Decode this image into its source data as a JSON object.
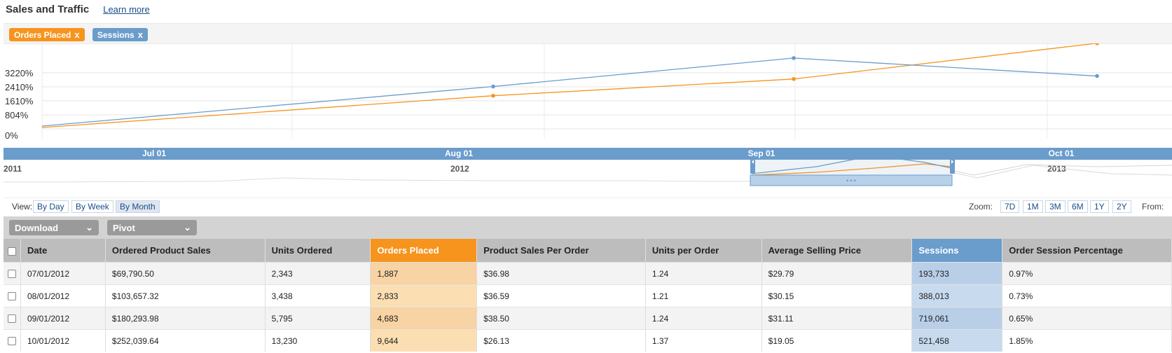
{
  "header": {
    "title": "Sales and Traffic",
    "learn_more": "Learn more"
  },
  "legend": {
    "orders_chip": {
      "label": "Orders Placed",
      "close": "x"
    },
    "sessions_chip": {
      "label": "Sessions",
      "close": "x"
    }
  },
  "colors": {
    "orders": "#f7941d",
    "sessions": "#6a9ccc",
    "axis_bar": "#6a9ccc"
  },
  "chart_data": {
    "type": "line",
    "x": [
      "Jul 01",
      "Aug 01",
      "Sep 01",
      "Oct 01"
    ],
    "y_ticks": [
      "0%",
      "804%",
      "1610%",
      "2410%",
      "3220%"
    ],
    "series": [
      {
        "name": "Orders Placed",
        "values": [
          0,
          1900,
          2860,
          4910
        ]
      },
      {
        "name": "Sessions",
        "values": [
          0,
          2430,
          4060,
          3030
        ]
      }
    ],
    "xlabel": "",
    "ylabel": "",
    "ylim": [
      0,
      4900
    ],
    "grid": true
  },
  "x_axis_labels": [
    "Jul 01",
    "Aug 01",
    "Sep 01",
    "Oct 01"
  ],
  "navigator": {
    "year_labels": [
      "2011",
      "2012",
      "2013"
    ],
    "handle_grip": "•••"
  },
  "view": {
    "label": "View:",
    "buttons": [
      "By Day",
      "By Week",
      "By Month"
    ],
    "active": "By Month"
  },
  "zoom": {
    "label": "Zoom:",
    "buttons": [
      "7D",
      "1M",
      "3M",
      "6M",
      "1Y",
      "2Y"
    ],
    "from_label": "From:"
  },
  "toolbar": {
    "download": "Download",
    "pivot": "Pivot",
    "chevron": "⌄"
  },
  "table": {
    "columns": [
      "Date",
      "Ordered Product Sales",
      "Units Ordered",
      "Orders Placed",
      "Product Sales Per Order",
      "Units per Order",
      "Average Selling Price",
      "Sessions",
      "Order Session Percentage"
    ],
    "rows": [
      [
        "07/01/2012",
        "$69,790.50",
        "2,343",
        "1,887",
        "$36.98",
        "1.24",
        "$29.79",
        "193,733",
        "0.97%"
      ],
      [
        "08/01/2012",
        "$103,657.32",
        "3,438",
        "2,833",
        "$36.59",
        "1.21",
        "$30.15",
        "388,013",
        "0.73%"
      ],
      [
        "09/01/2012",
        "$180,293.98",
        "5,795",
        "4,683",
        "$38.50",
        "1.24",
        "$31.11",
        "719,061",
        "0.65%"
      ],
      [
        "10/01/2012",
        "$252,039.64",
        "13,230",
        "9,644",
        "$26.13",
        "1.37",
        "$19.05",
        "521,458",
        "1.85%"
      ]
    ]
  }
}
